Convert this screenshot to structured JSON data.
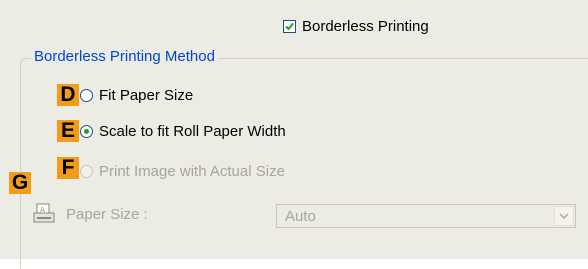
{
  "borderless": {
    "label": "Borderless Printing",
    "checked": true
  },
  "group": {
    "title": "Borderless Printing Method"
  },
  "options": [
    {
      "letter": "D",
      "label": "Fit Paper Size",
      "selected": false,
      "enabled": true
    },
    {
      "letter": "E",
      "label": "Scale to fit Roll Paper Width",
      "selected": true,
      "enabled": true
    },
    {
      "letter": "F",
      "label": "Print Image with Actual Size",
      "selected": false,
      "enabled": false
    }
  ],
  "extra_letter": "G",
  "paper_size": {
    "label": "Paper Size :",
    "value": "Auto",
    "enabled": false
  },
  "colors": {
    "accent_letter_bg": "#f29c1a",
    "group_title": "#0046d5",
    "disabled_text": "#a7a69e",
    "selected_dot": "#21a121"
  }
}
